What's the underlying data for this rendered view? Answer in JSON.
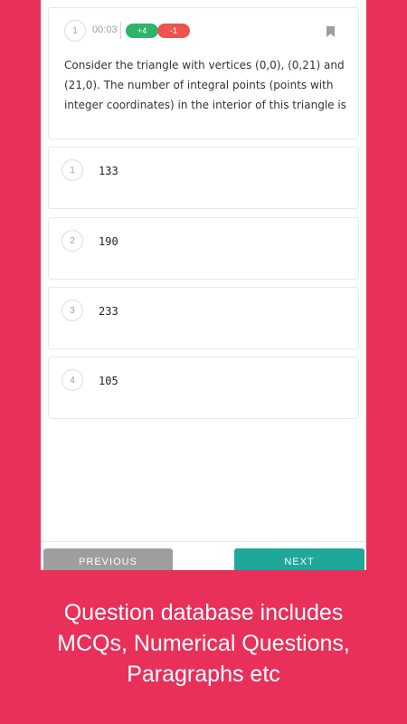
{
  "question": {
    "number": "1",
    "timer": "00:03",
    "positive_marks": "+4",
    "negative_marks": "-1",
    "text": "Consider the triangle with vertices (0,0), (0,21) and (21,0). The number of integral points (points with integer coordinates) in the interior of this triangle is"
  },
  "options": [
    {
      "number": "1",
      "text": "133"
    },
    {
      "number": "2",
      "text": "190"
    },
    {
      "number": "3",
      "text": "233"
    },
    {
      "number": "4",
      "text": "105"
    }
  ],
  "nav": {
    "previous_label": "PREVIOUS",
    "next_label": "NEXT"
  },
  "caption": {
    "line1": "Question database includes",
    "line2": "MCQs, Numerical Questions,",
    "line3": "Paragraphs etc"
  },
  "colors": {
    "background": "#E8305B",
    "positive": "#2FB36B",
    "negative": "#EF5350",
    "next_button": "#1FA899",
    "previous_button": "#9E9E9E"
  },
  "icons": {
    "bookmark": "bookmark-icon"
  }
}
